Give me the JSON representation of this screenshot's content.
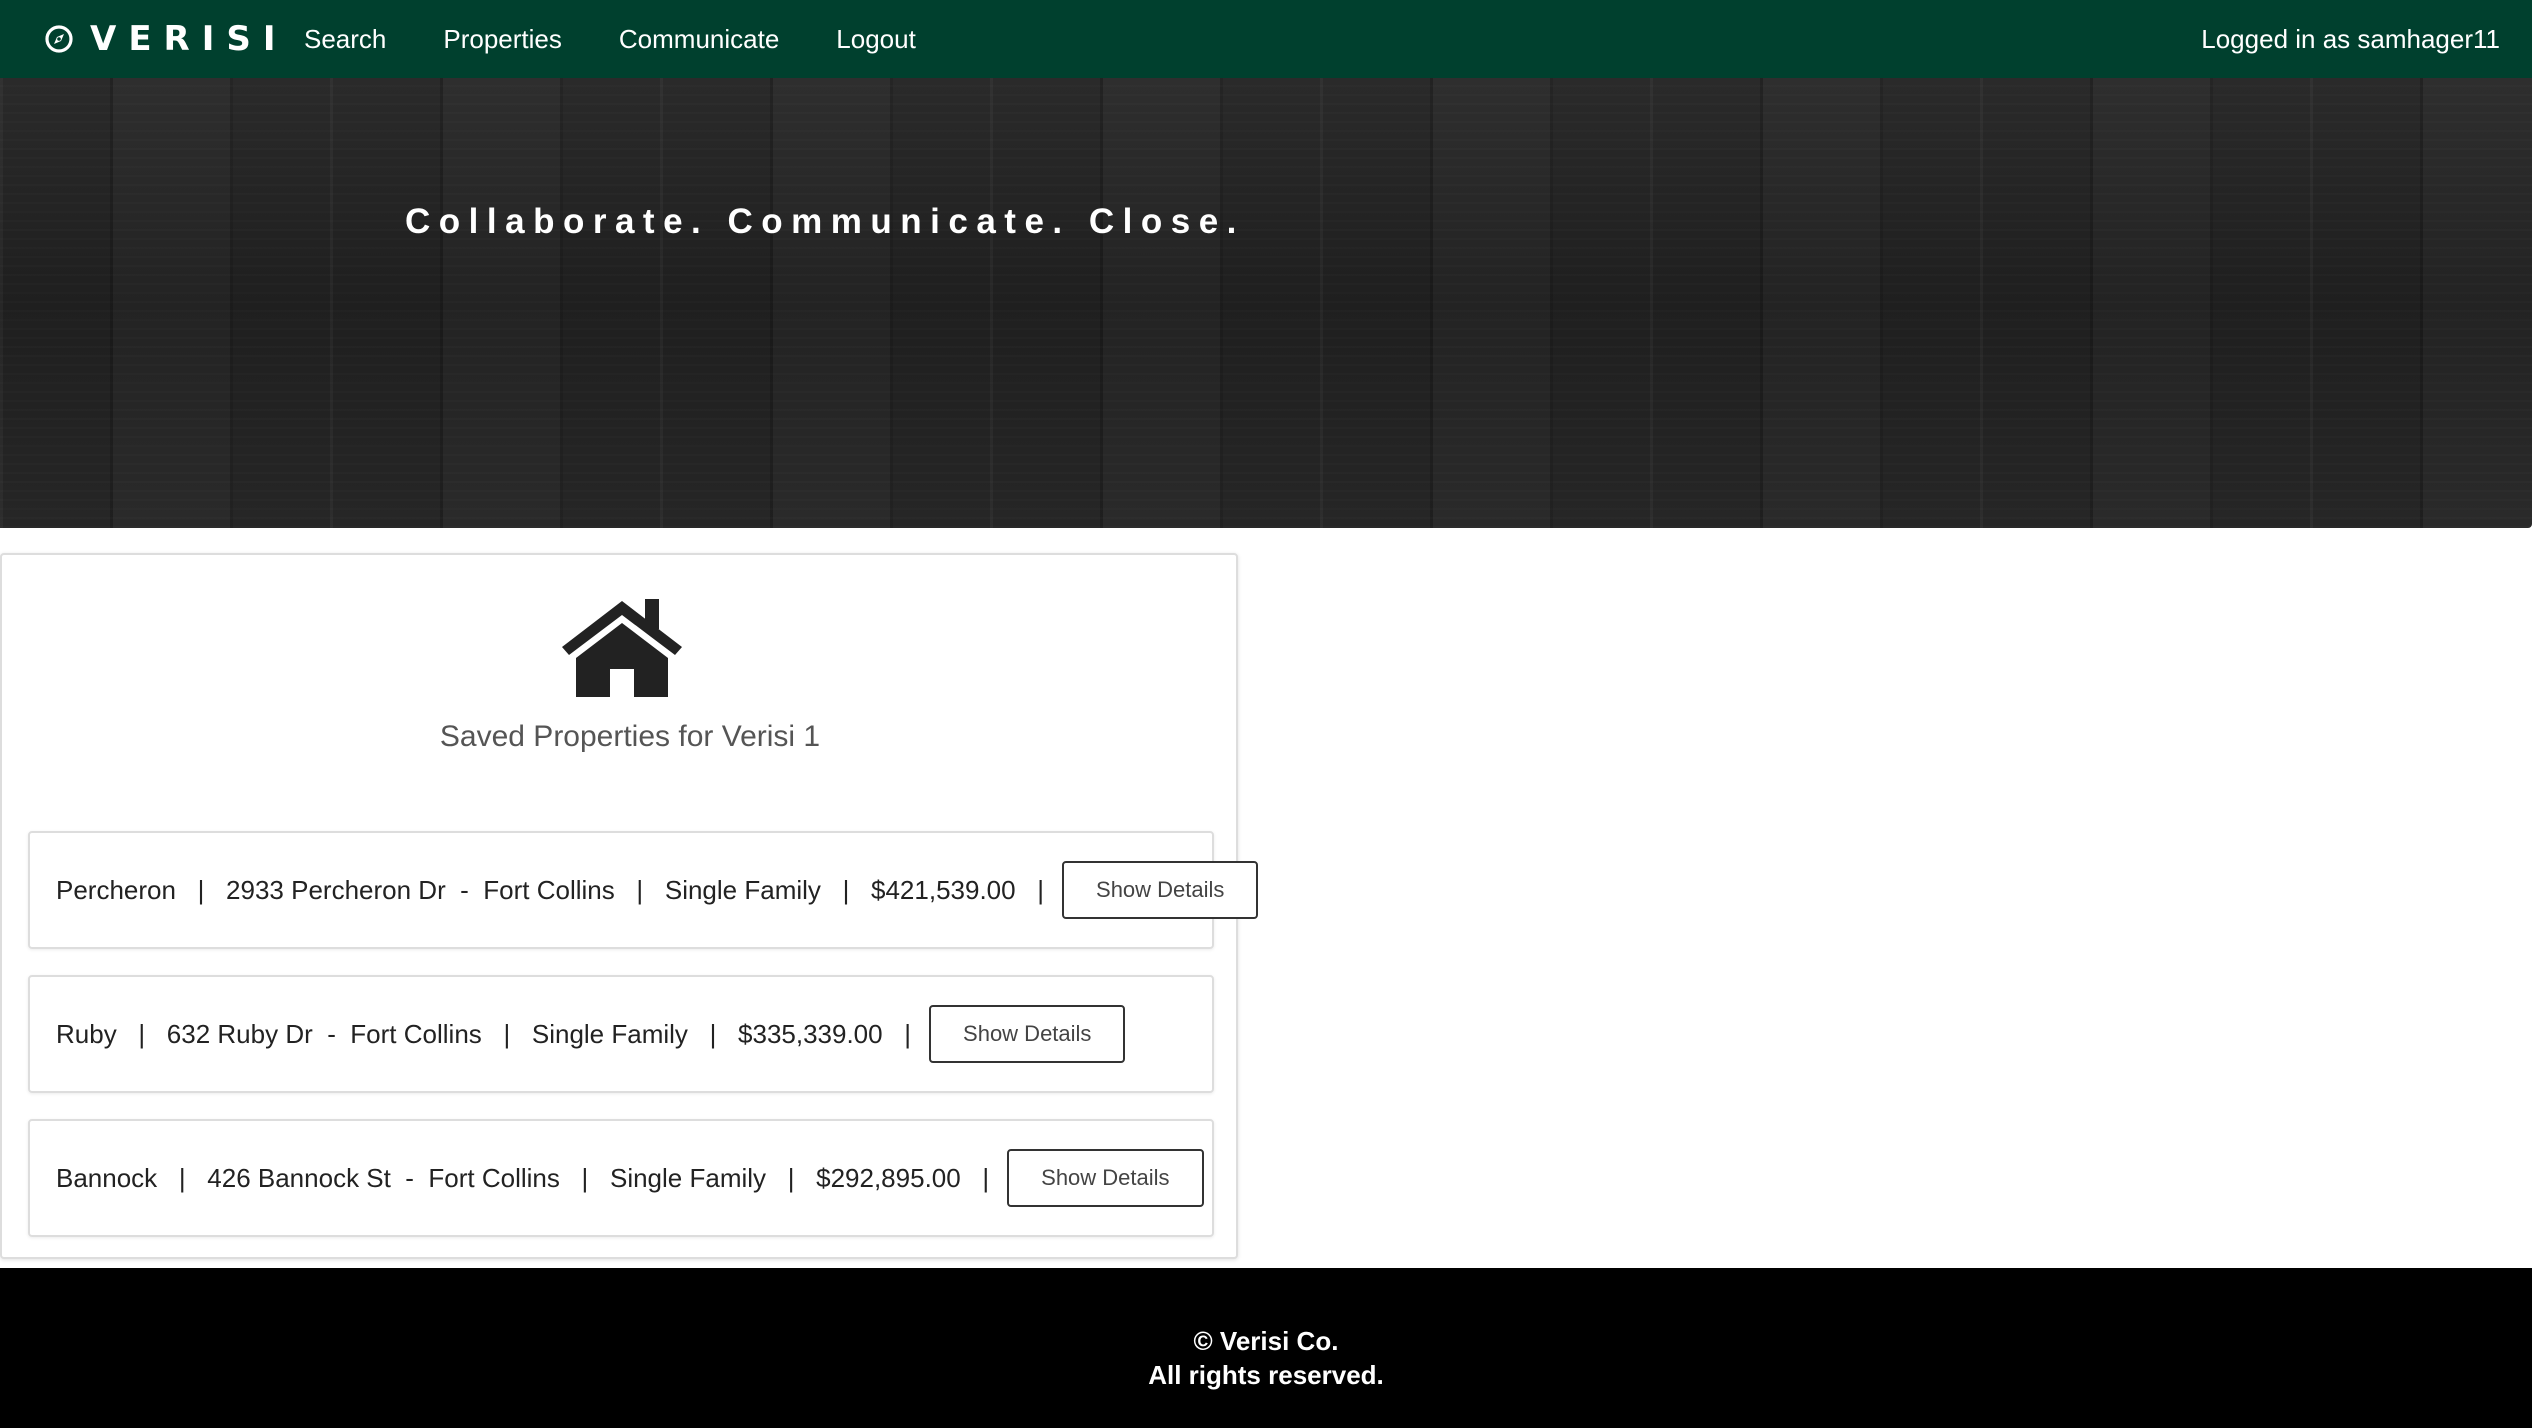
{
  "navbar": {
    "brand": "VERISI",
    "brand_icon": "compass-icon",
    "links": [
      "Search",
      "Properties",
      "Communicate",
      "Logout"
    ],
    "user_status": "Logged in as samhager11",
    "background": "#00402e"
  },
  "hero": {
    "tagline": "Collaborate. Communicate. Close."
  },
  "saved": {
    "icon": "house-icon",
    "title": "Saved Properties for Verisi 1",
    "properties": [
      {
        "summary": "Percheron   |   2933 Percheron Dr  -  Fort Collins   |   Single Family   |   $421,539.00   |",
        "button": "Show Details"
      },
      {
        "summary": "Ruby   |   632 Ruby Dr  -  Fort Collins   |   Single Family   |   $335,339.00   |",
        "button": "Show Details"
      },
      {
        "summary": "Bannock   |   426 Bannock St  -  Fort Collins   |   Single Family   |   $292,895.00   |",
        "button": "Show Details"
      }
    ]
  },
  "footer": {
    "copyright": "© Verisi Co.",
    "rights": "All rights reserved."
  }
}
